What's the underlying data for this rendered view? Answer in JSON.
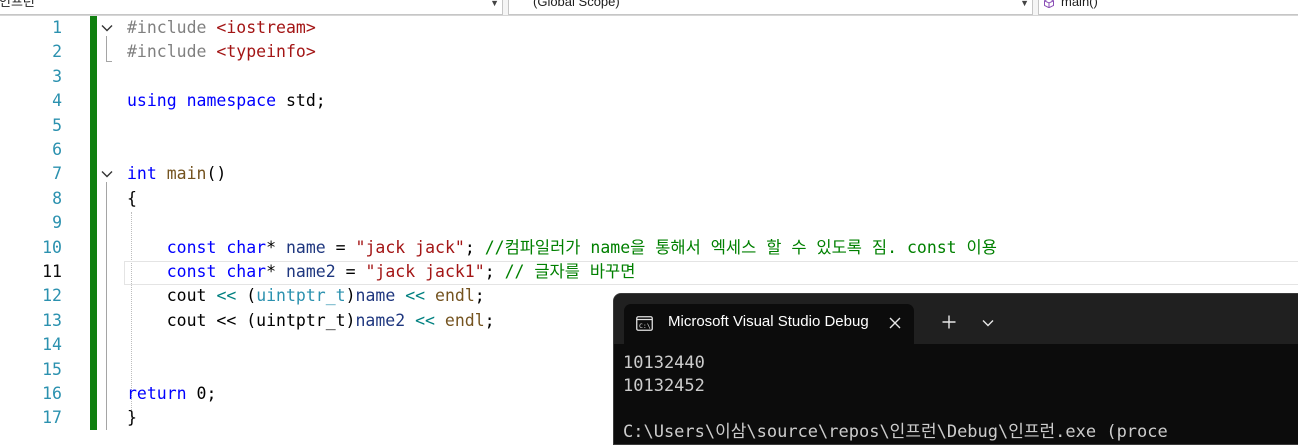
{
  "navbar": {
    "project": "인프런",
    "scope": "(Global Scope)",
    "member": "main()",
    "member_icon": "cube-icon",
    "dropdown_icon": "triangle-down-icon"
  },
  "editor": {
    "line_numbers": [
      "1",
      "2",
      "3",
      "4",
      "5",
      "6",
      "7",
      "8",
      "9",
      "10",
      "11",
      "12",
      "13",
      "14",
      "15",
      "16",
      "17"
    ],
    "current_line": 11,
    "colors": {
      "keyword": "#0000ff",
      "preprocessor": "#808080",
      "string": "#a31515",
      "comment": "#008000",
      "type": "#2b91af",
      "function": "#74531f",
      "change_bar": "#108010"
    },
    "lines": {
      "l1": {
        "directive": "#include",
        "header": "<iostream>"
      },
      "l2": {
        "directive": "#include",
        "header": "<typeinfo>"
      },
      "l4": {
        "kw1": "using",
        "kw2": "namespace",
        "rest": "std;"
      },
      "l7": {
        "kw": "int",
        "fn": "main",
        "rest": "()"
      },
      "l8": {
        "text": "{"
      },
      "l10": {
        "kw1": "const",
        "kw2": "char",
        "star": "*",
        "var": "name",
        "eq": "=",
        "str": "\"jack jack\"",
        "semi": ";",
        "comment": "//컴파일러가 name을 통해서 엑세스 할 수 있도록 짐. const 이용"
      },
      "l11": {
        "kw1": "const",
        "kw2": "char",
        "star": "*",
        "var": "name2",
        "eq": "=",
        "str": "\"jack jack1\"",
        "semi": ";",
        "comment": "// 글자를 바꾸면"
      },
      "l12": {
        "cout": "cout",
        "op": "<<",
        "open": "(",
        "type": "uintptr_t",
        "close": ")",
        "var": "name",
        "op2": "<<",
        "endl": "endl",
        "semi": ";"
      },
      "l13": {
        "text": "cout << (uintptr_t)",
        "var": "name2",
        "op2": "<<",
        "endl": "endl",
        "semi": ";"
      },
      "l16": {
        "kw": "return",
        "rest": "0;"
      },
      "l17": {
        "text": "}"
      }
    }
  },
  "terminal": {
    "tab_title": "Microsoft Visual Studio Debug",
    "tab_icon": "console-icon",
    "close_icon": "close-icon",
    "new_tab_icon": "plus-icon",
    "dropdown_icon": "chevron-down-icon",
    "output": [
      "10132440",
      "10132452",
      "",
      "C:\\Users\\이삼\\source\\repos\\인프런\\Debug\\인프런.exe (proce"
    ]
  }
}
